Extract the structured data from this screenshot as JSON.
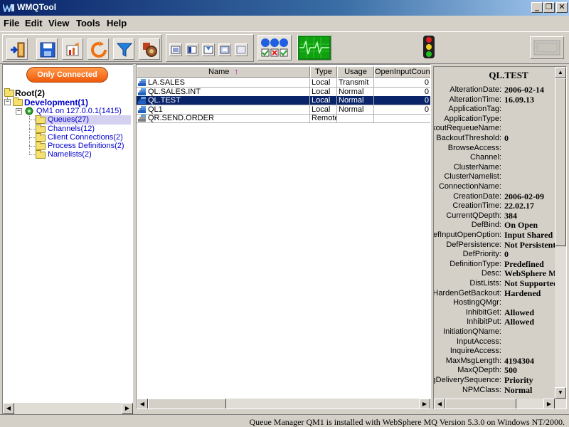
{
  "window": {
    "title": "WMQTool"
  },
  "menu": [
    "File",
    "Edit",
    "View",
    "Tools",
    "Help"
  ],
  "toolbar": {
    "icons": [
      "exit-icon",
      "save-icon",
      "chart-icon",
      "refresh-icon",
      "filter-icon",
      "settings-icon",
      "view-icon",
      "status-lights-icon",
      "monitor-icon",
      "traffic-light-icon",
      "panel-icon"
    ]
  },
  "left": {
    "only_connected": "Only Connected",
    "tree": {
      "root": "Root(2)",
      "development": "Development(1)",
      "qmgr": "QM1  on 127.0.0.1(1415)",
      "children": [
        "Queues(27)",
        "Channels(12)",
        "Client Connections(2)",
        "Process Definitions(2)",
        "Namelists(2)"
      ]
    }
  },
  "table": {
    "columns": [
      "Name",
      "Type",
      "Usage",
      "OpenInputCount"
    ],
    "sort_arrow": "↑",
    "rows": [
      {
        "name": "LA.SALES",
        "type": "Local",
        "usage": "Transmit",
        "open": "0",
        "selected": false
      },
      {
        "name": "QL.SALES.INT",
        "type": "Local",
        "usage": "Normal",
        "open": "0",
        "selected": false
      },
      {
        "name": "QL.TEST",
        "type": "Local",
        "usage": "Normal",
        "open": "0",
        "selected": true
      },
      {
        "name": "QL1",
        "type": "Local",
        "usage": "Normal",
        "open": "0",
        "selected": false
      },
      {
        "name": "QR.SEND.ORDER",
        "type": "Remote",
        "usage": "",
        "open": "",
        "selected": false
      }
    ]
  },
  "props": {
    "title": "QL.TEST",
    "items": [
      {
        "k": "AlterationDate:",
        "v": "2006-02-14"
      },
      {
        "k": "AlterationTime:",
        "v": "16.09.13"
      },
      {
        "k": "ApplicationTag:",
        "v": ""
      },
      {
        "k": "ApplicationType:",
        "v": ""
      },
      {
        "k": "BackoutRequeueName:",
        "v": ""
      },
      {
        "k": "BackoutThreshold:",
        "v": "0"
      },
      {
        "k": "BrowseAccess:",
        "v": ""
      },
      {
        "k": "Channel:",
        "v": ""
      },
      {
        "k": "ClusterName:",
        "v": ""
      },
      {
        "k": "ClusterNamelist:",
        "v": ""
      },
      {
        "k": "ConnectionName:",
        "v": ""
      },
      {
        "k": "CreationDate:",
        "v": "2006-02-09"
      },
      {
        "k": "CreationTime:",
        "v": "22.02.17"
      },
      {
        "k": "CurrentQDepth:",
        "v": "384"
      },
      {
        "k": "DefBind:",
        "v": "On Open"
      },
      {
        "k": "DefInputOpenOption:",
        "v": "Input Shared"
      },
      {
        "k": "DefPersistence:",
        "v": "Not Persistent"
      },
      {
        "k": "DefPriority:",
        "v": "0"
      },
      {
        "k": "DefinitionType:",
        "v": "Predefined"
      },
      {
        "k": "Desc:",
        "v": "WebSphere MQ"
      },
      {
        "k": "DistLists:",
        "v": "Not Supported"
      },
      {
        "k": "HardenGetBackout:",
        "v": "Hardened"
      },
      {
        "k": "HostingQMgr:",
        "v": ""
      },
      {
        "k": "InhibitGet:",
        "v": "Allowed"
      },
      {
        "k": "InhibitPut:",
        "v": "Allowed"
      },
      {
        "k": "InitiationQName:",
        "v": ""
      },
      {
        "k": "InputAccess:",
        "v": ""
      },
      {
        "k": "InquireAccess:",
        "v": ""
      },
      {
        "k": "MaxMsgLength:",
        "v": "4194304"
      },
      {
        "k": "MaxQDepth:",
        "v": "500"
      },
      {
        "k": "MsgDeliverySequence:",
        "v": "Priority"
      },
      {
        "k": "NPMClass:",
        "v": "Normal"
      }
    ]
  },
  "status": "Queue Manager QM1  is installed with WebSphere MQ Version 5.3.0 on Windows NT/2000."
}
